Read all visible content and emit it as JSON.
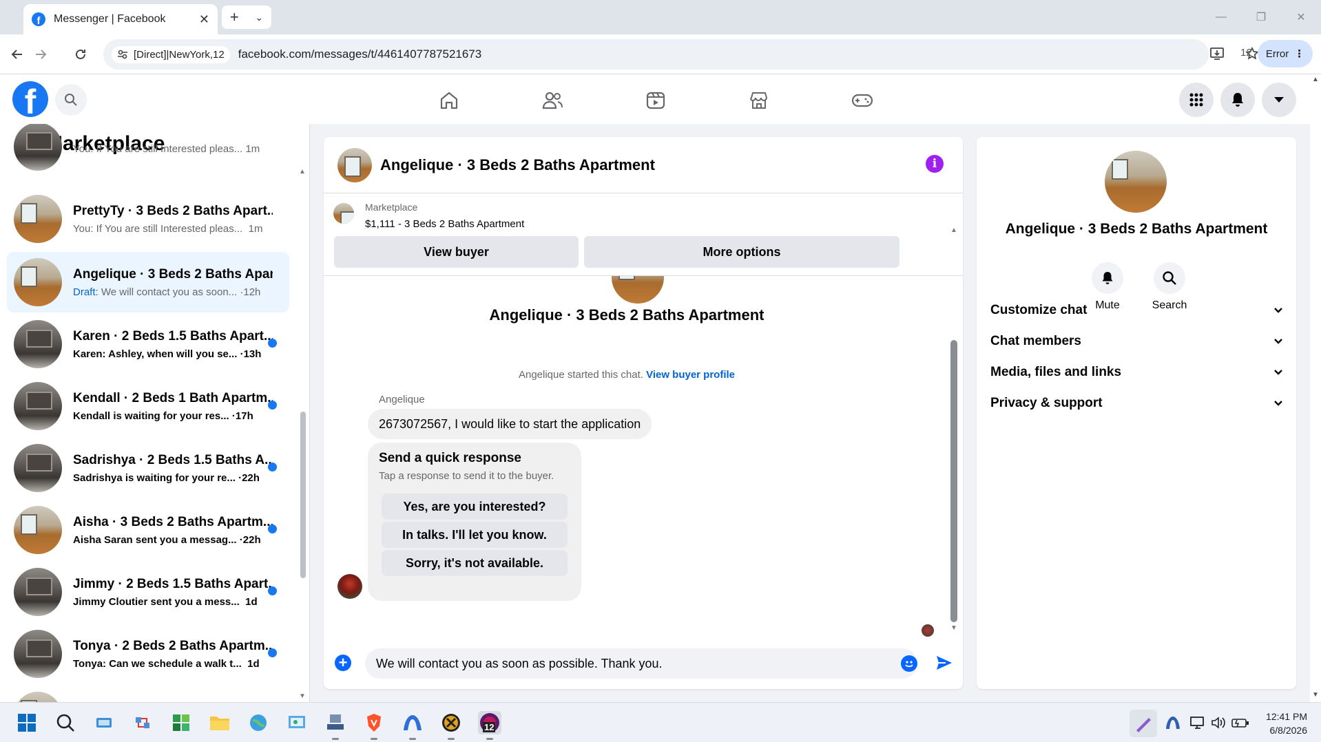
{
  "browser": {
    "tab_title": "Messenger | Facebook",
    "site_chip": "[Direct]|NewYork,12",
    "url": "facebook.com/messages/t/4461407787521673",
    "extension_count": "12",
    "profile_status": "Error"
  },
  "sidebar": {
    "title": "Marketplace",
    "conversations": [
      {
        "name": "",
        "preview": "You: If You are still Interested pleas...",
        "time": "1m",
        "unread": false,
        "prefix": ""
      },
      {
        "name": "PrettyTy · 3 Beds 2 Baths Apart...",
        "preview": "You: If You are still Interested pleas...",
        "time": "1m",
        "unread": false,
        "prefix": ""
      },
      {
        "name": "Angelique · 3 Beds 2 Baths Apar...",
        "preview": "We will contact you as soon...",
        "time": "12h",
        "unread": false,
        "prefix": "Draft:"
      },
      {
        "name": "Karen · 2 Beds 1.5 Baths Apart...",
        "preview": "Karen: Ashley, when will you se...",
        "time": "13h",
        "unread": true,
        "prefix": ""
      },
      {
        "name": "Kendall · 2 Beds 1 Bath Apartm...",
        "preview": "Kendall is waiting for your res...",
        "time": "17h",
        "unread": true,
        "prefix": ""
      },
      {
        "name": "Sadrishya · 2 Beds 1.5 Baths A...",
        "preview": "Sadrishya is waiting for your re...",
        "time": "22h",
        "unread": true,
        "prefix": ""
      },
      {
        "name": "Aisha · 3 Beds 2 Baths Apartm...",
        "preview": "Aisha Saran sent you a messag...",
        "time": "22h",
        "unread": true,
        "prefix": ""
      },
      {
        "name": "Jimmy · 2 Beds 1.5 Baths Apart...",
        "preview": "Jimmy Cloutier sent you a mess...",
        "time": "1d",
        "unread": true,
        "prefix": ""
      },
      {
        "name": "Tonya · 2 Beds 2 Baths Apartm...",
        "preview": "Tonya: Can we schedule a walk t...",
        "time": "1d",
        "unread": true,
        "prefix": ""
      }
    ]
  },
  "chat": {
    "title": "Angelique · 3 Beds 2 Baths Apartment",
    "listing_source": "Marketplace",
    "listing_title": "$1,111 - 3 Beds 2 Baths Apartment",
    "view_buyer": "View buyer",
    "more_options": "More options",
    "started_text": "Angelique started this chat.",
    "view_profile": "View buyer profile",
    "sender": "Angelique",
    "message": "2673072567, I would like to start the application",
    "quick_title": "Send a quick response",
    "quick_sub": "Tap a response to send it to the buyer.",
    "quick_replies": [
      "Yes, are you interested?",
      "In talks. I'll let you know.",
      "Sorry, it's not available."
    ],
    "composer_text": "We will contact you as soon as possible. Thank you."
  },
  "details": {
    "name": "Angelique · 3 Beds 2 Baths Apartment",
    "mute": "Mute",
    "search": "Search",
    "sections": [
      "Customize chat",
      "Chat members",
      "Media, files and links",
      "Privacy & support"
    ]
  },
  "taskbar": {
    "time": "12:41 PM",
    "date": "6/8/2026",
    "badge": "12"
  },
  "colors": {
    "accent": "#1877f2",
    "info": "#a020f0",
    "active_row": "#ebf5ff"
  }
}
